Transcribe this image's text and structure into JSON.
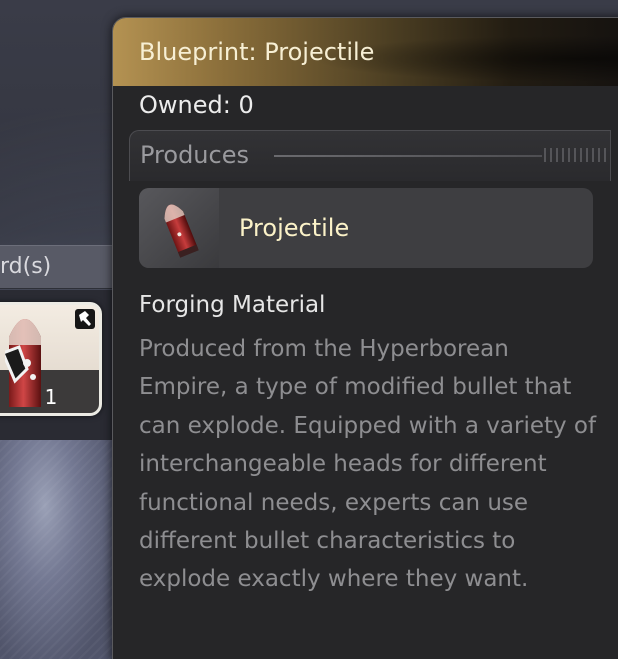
{
  "background": {
    "strip_label": "rd(s)",
    "slot": {
      "quantity": "1",
      "icon": "projectile-bullet-icon",
      "corner_icon": "hammer-icon"
    }
  },
  "tooltip": {
    "title": "Blueprint: Projectile",
    "owned": "Owned: 0",
    "produces_label": "Produces",
    "product": {
      "name": "Projectile",
      "icon": "projectile-bullet-icon"
    },
    "category": "Forging Material",
    "description": "Produced from the Hyperborean Empire, a type of modified bullet that can explode. Equipped with a variety of interchangeable heads for different functional needs, experts can use different bullet characteristics to explode exactly where they want."
  },
  "colors": {
    "header_gold": "#b49252",
    "product_name": "#fbf2c8",
    "description": "#8e8e91"
  }
}
